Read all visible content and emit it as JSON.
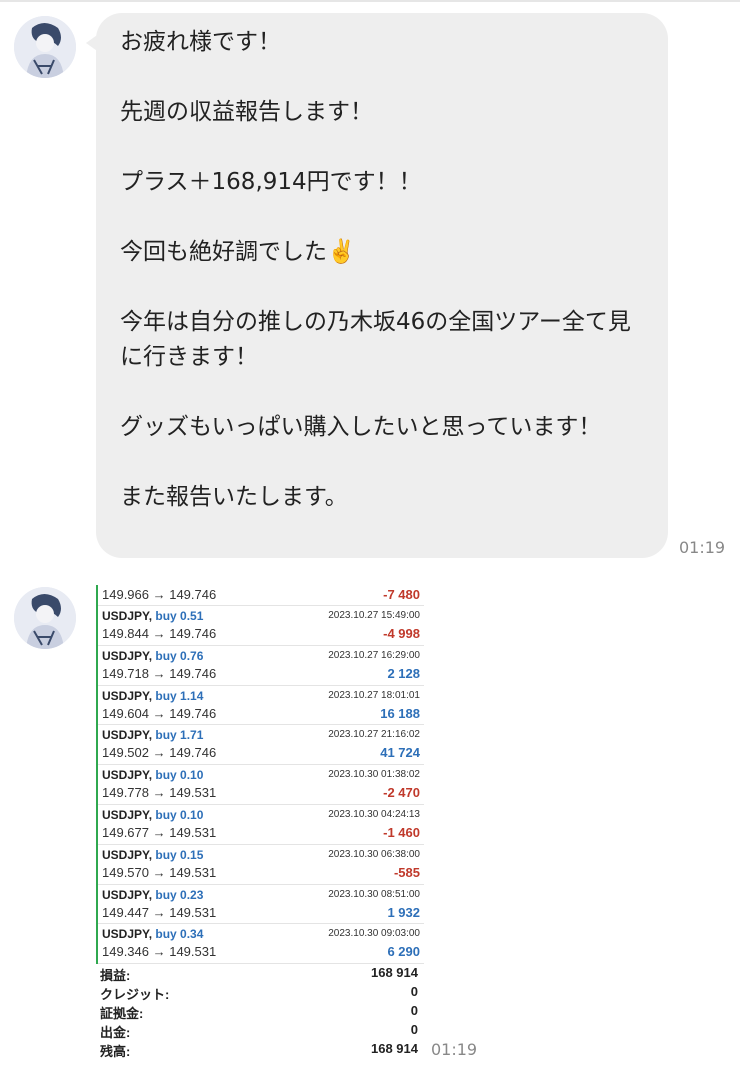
{
  "message1": {
    "paragraphs": [
      "お疲れ様です！",
      "先週の収益報告します！",
      "プラス＋168,914円です！！",
      "今回も絶好調でした✌️",
      "今年は自分の推しの乃木坂46の全国ツアー全て見に行きます！",
      "グッズもいっぱい購入したいと思っています！",
      "また報告いたします。"
    ],
    "time": "01:19"
  },
  "message2": {
    "time": "01:19",
    "first_row": {
      "prices": "149.966 → 149.746",
      "profit": "-7 480",
      "sign": "neg"
    },
    "trades": [
      {
        "symbol": "USDJPY,",
        "side": "buy 0.51",
        "datetime": "2023.10.27 15:49:00",
        "prices": "149.844 → 149.746",
        "profit": "-4 998",
        "sign": "neg"
      },
      {
        "symbol": "USDJPY,",
        "side": "buy 0.76",
        "datetime": "2023.10.27 16:29:00",
        "prices": "149.718 → 149.746",
        "profit": "2 128",
        "sign": "pos"
      },
      {
        "symbol": "USDJPY,",
        "side": "buy 1.14",
        "datetime": "2023.10.27 18:01:01",
        "prices": "149.604 → 149.746",
        "profit": "16 188",
        "sign": "pos"
      },
      {
        "symbol": "USDJPY,",
        "side": "buy 1.71",
        "datetime": "2023.10.27 21:16:02",
        "prices": "149.502 → 149.746",
        "profit": "41 724",
        "sign": "pos"
      },
      {
        "symbol": "USDJPY,",
        "side": "buy 0.10",
        "datetime": "2023.10.30 01:38:02",
        "prices": "149.778 → 149.531",
        "profit": "-2 470",
        "sign": "neg"
      },
      {
        "symbol": "USDJPY,",
        "side": "buy 0.10",
        "datetime": "2023.10.30 04:24:13",
        "prices": "149.677 → 149.531",
        "profit": "-1 460",
        "sign": "neg"
      },
      {
        "symbol": "USDJPY,",
        "side": "buy 0.15",
        "datetime": "2023.10.30 06:38:00",
        "prices": "149.570 → 149.531",
        "profit": "-585",
        "sign": "neg"
      },
      {
        "symbol": "USDJPY,",
        "side": "buy 0.23",
        "datetime": "2023.10.30 08:51:00",
        "prices": "149.447 → 149.531",
        "profit": "1 932",
        "sign": "pos"
      },
      {
        "symbol": "USDJPY,",
        "side": "buy 0.34",
        "datetime": "2023.10.30 09:03:00",
        "prices": "149.346 → 149.531",
        "profit": "6 290",
        "sign": "pos"
      }
    ],
    "summary": [
      {
        "label": "損益:",
        "value": "168 914"
      },
      {
        "label": "クレジット:",
        "value": "0"
      },
      {
        "label": "証拠金:",
        "value": "0"
      },
      {
        "label": "出金:",
        "value": "0"
      },
      {
        "label": "残高:",
        "value": "168 914"
      }
    ]
  },
  "colors": {
    "bubble": "#eeeeee",
    "negative": "#c0392b",
    "positive": "#2d6fb8",
    "accent_bar": "#2fa84f"
  }
}
